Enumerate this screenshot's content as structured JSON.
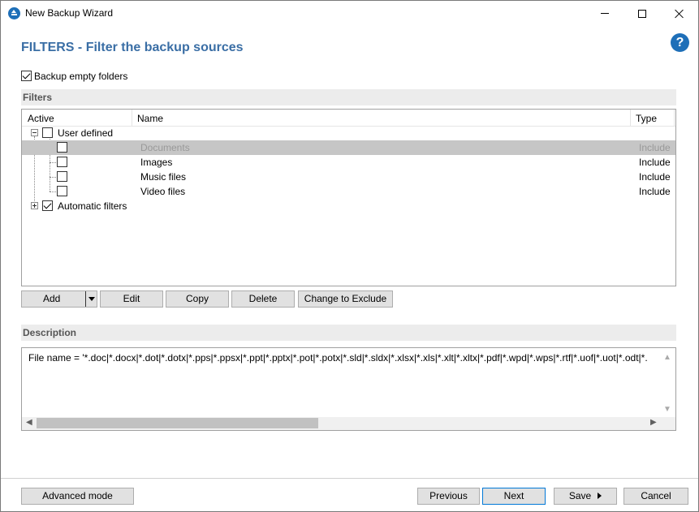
{
  "window": {
    "title": "New Backup Wizard"
  },
  "header": {
    "title": "FILTERS - Filter the backup sources",
    "help": "?"
  },
  "options": {
    "backup_empty_folders": {
      "label": "Backup empty folders",
      "checked": true
    }
  },
  "filters_section": {
    "title": "Filters"
  },
  "grid": {
    "columns": [
      "Active",
      "Name",
      "Type"
    ],
    "groups": [
      {
        "label": "User defined",
        "expanded": true,
        "checked": false,
        "rows": [
          {
            "name": "Documents",
            "type": "Include",
            "checked": false,
            "selected": true
          },
          {
            "name": "Images",
            "type": "Include",
            "checked": false,
            "selected": false
          },
          {
            "name": "Music files",
            "type": "Include",
            "checked": false,
            "selected": false
          },
          {
            "name": "Video files",
            "type": "Include",
            "checked": false,
            "selected": false
          }
        ]
      },
      {
        "label": "Automatic filters",
        "expanded": false,
        "checked": true,
        "rows": []
      }
    ]
  },
  "actions": {
    "add": "Add",
    "edit": "Edit",
    "copy": "Copy",
    "delete": "Delete",
    "change_to_exclude": "Change to Exclude"
  },
  "description_section": {
    "title": "Description",
    "text": "File name = '*.doc|*.docx|*.dot|*.dotx|*.pps|*.ppsx|*.ppt|*.pptx|*.pot|*.potx|*.sld|*.sldx|*.xlsx|*.xls|*.xlt|*.xltx|*.pdf|*.wpd|*.wps|*.rtf|*.uof|*.uot|*.odt|*."
  },
  "footer": {
    "advanced_mode": "Advanced mode",
    "previous": "Previous",
    "next": "Next",
    "save": "Save",
    "cancel": "Cancel"
  },
  "colors": {
    "accent": "#3a6ea5",
    "icon_blue": "#1e6fb8",
    "selection": "#c6c6c6"
  }
}
